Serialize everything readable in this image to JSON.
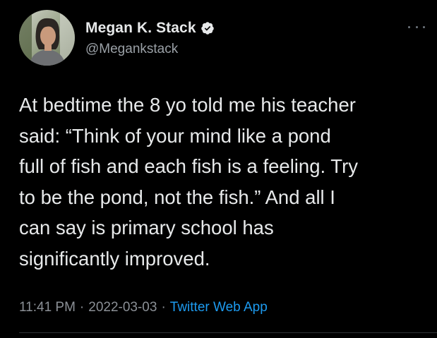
{
  "author": {
    "display_name": "Megan K. Stack",
    "handle": "@Megankstack",
    "verified": true
  },
  "tweet": {
    "text_lines": [
      "At bedtime the 8 yo told me his teacher",
      "said: “Think of your mind like a pond",
      "full of fish and each fish is a feeling. Try",
      "to be the pond, not the fish.” And all I",
      "can say is primary school has",
      "significantly improved."
    ],
    "time": "11:41 PM",
    "date": "2022-03-03",
    "separator": "·",
    "source": "Twitter Web App"
  },
  "colors": {
    "background": "#000000",
    "text": "#e7e9ea",
    "secondary": "#8b9096",
    "link": "#1d9bf0",
    "verified_badge": "#e7e9ea"
  },
  "icons": {
    "verified": "verified-badge-icon",
    "more": "more-horizontal-icon"
  }
}
